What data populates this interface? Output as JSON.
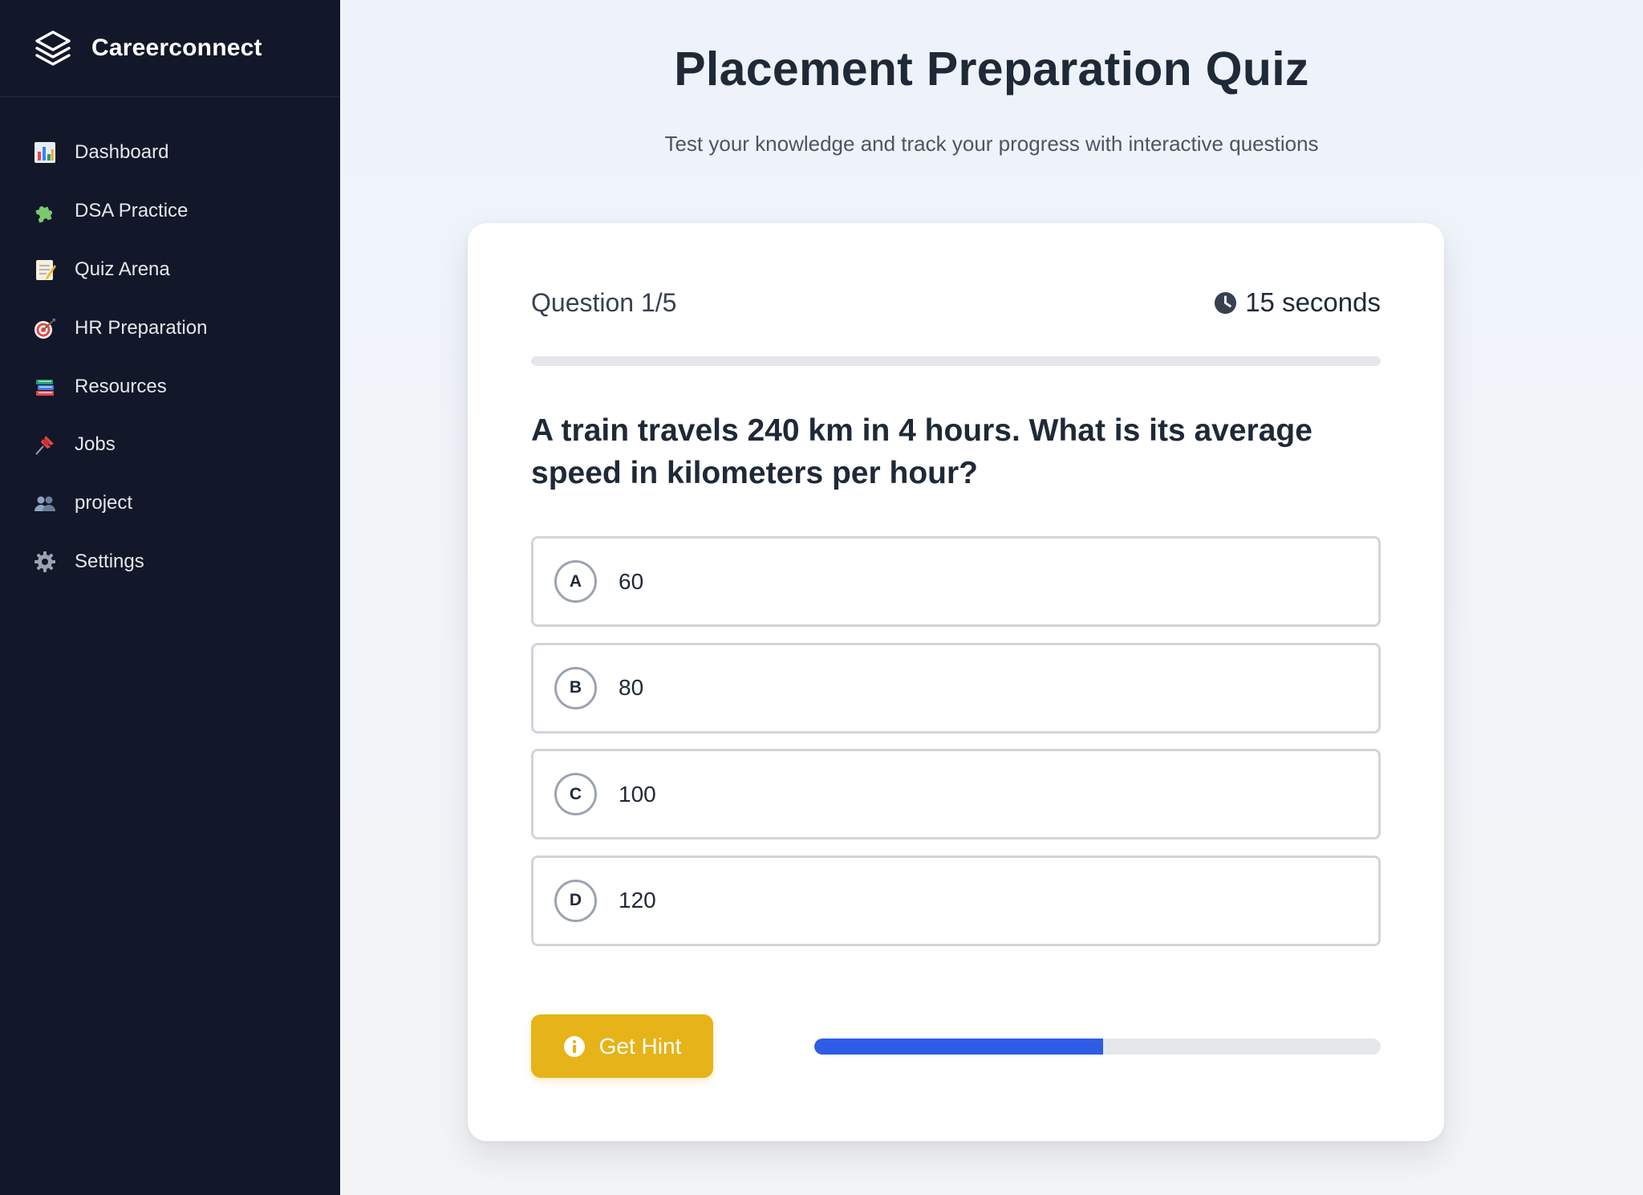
{
  "app": {
    "name": "Careerconnect",
    "logo_icon": "layers-icon"
  },
  "sidebar": {
    "items": [
      {
        "label": "Dashboard",
        "icon": "bar-chart-icon"
      },
      {
        "label": "DSA Practice",
        "icon": "puzzle-piece-icon"
      },
      {
        "label": "Quiz Arena",
        "icon": "memo-icon"
      },
      {
        "label": "HR Preparation",
        "icon": "target-icon"
      },
      {
        "label": "Resources",
        "icon": "books-icon"
      },
      {
        "label": "Jobs",
        "icon": "pushpin-icon"
      },
      {
        "label": "project",
        "icon": "people-icon"
      },
      {
        "label": "Settings",
        "icon": "gear-icon"
      }
    ]
  },
  "header": {
    "title": "Placement Preparation Quiz",
    "subtitle": "Test your knowledge and track your progress with interactive questions"
  },
  "quiz": {
    "counter": "Question 1/5",
    "timer_label": "15 seconds",
    "timer_icon": "clock-icon",
    "question": "A train travels 240 km in 4 hours. What is its average speed in kilometers per hour?",
    "options": [
      {
        "letter": "A",
        "text": "60"
      },
      {
        "letter": "B",
        "text": "80"
      },
      {
        "letter": "C",
        "text": "100"
      },
      {
        "letter": "D",
        "text": "120"
      }
    ],
    "hint_label": "Get Hint",
    "hint_icon": "info-icon",
    "progress_fraction": 0.51
  },
  "colors": {
    "sidebar_bg": "#121729",
    "accent_blue": "#2f5ce6",
    "hint_yellow": "#e6b318"
  }
}
